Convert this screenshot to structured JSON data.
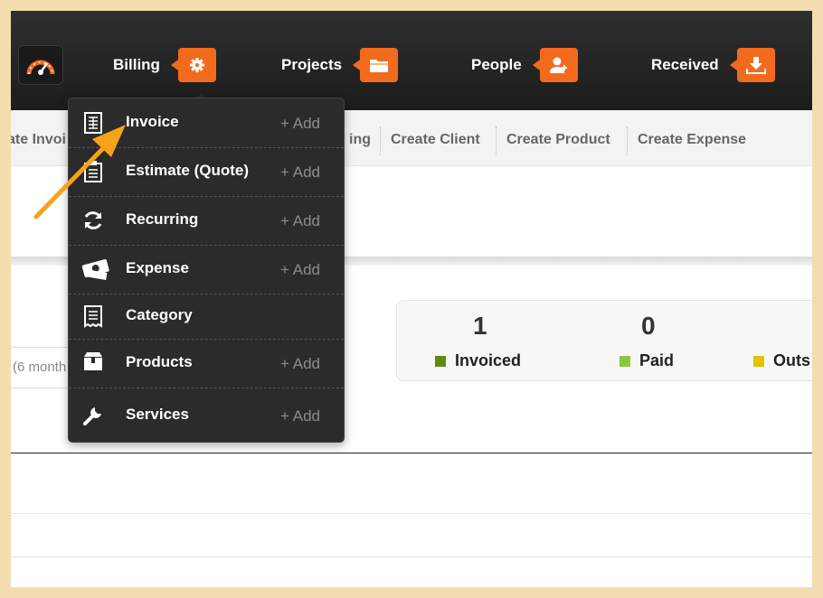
{
  "nav": {
    "items": [
      {
        "label": "Billing",
        "icon": "gear-icon"
      },
      {
        "label": "Projects",
        "icon": "folder-icon"
      },
      {
        "label": "People",
        "icon": "add-user-icon"
      },
      {
        "label": "Received",
        "icon": "download-icon"
      }
    ],
    "logo_icon": "speedometer-icon",
    "accent_color": "#f26b1d"
  },
  "subnav": {
    "items": [
      "ate Invoi",
      "ing",
      "Create Client",
      "Create Product",
      "Create Expense"
    ]
  },
  "dropdown": {
    "items": [
      {
        "label": "Invoice",
        "add": "+ Add",
        "icon": "invoice-icon"
      },
      {
        "label": "Estimate (Quote)",
        "add": "+ Add",
        "icon": "estimate-icon"
      },
      {
        "label": "Recurring",
        "add": "+ Add",
        "icon": "refresh-icon"
      },
      {
        "label": "Expense",
        "add": "+ Add",
        "icon": "money-icon"
      },
      {
        "label": "Category",
        "add": "",
        "icon": "receipt-icon"
      },
      {
        "label": "Products",
        "add": "+ Add",
        "icon": "box-icon"
      },
      {
        "label": "Services",
        "add": "+ Add",
        "icon": "wrench-icon"
      }
    ]
  },
  "period": {
    "text": "(6 month"
  },
  "stats": {
    "items": [
      {
        "value": "1",
        "label": "Invoiced",
        "color": "#5f8a0f"
      },
      {
        "value": "0",
        "label": "Paid",
        "color": "#8cc63f"
      },
      {
        "value": "",
        "label": "Outs",
        "color": "#e5c100"
      }
    ]
  }
}
